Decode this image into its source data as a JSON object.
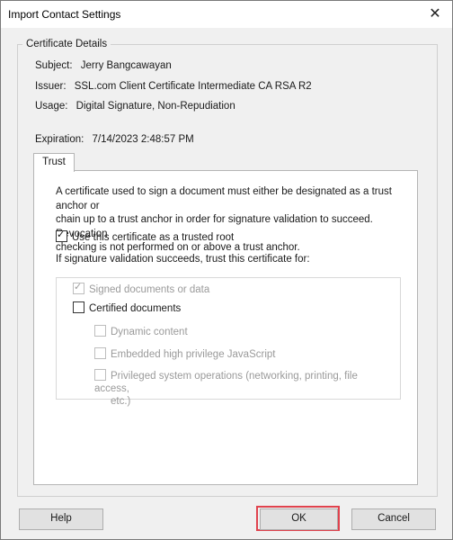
{
  "window": {
    "title": "Import Contact Settings",
    "close_glyph": "✕"
  },
  "details": {
    "legend": "Certificate Details",
    "subject_label": "Subject:",
    "subject_value": "Jerry Bangcawayan",
    "issuer_label": "Issuer:",
    "issuer_value": "SSL.com Client Certificate Intermediate CA RSA R2",
    "usage_label": "Usage:",
    "usage_value": "Digital Signature, Non-Repudiation",
    "expiration_label": "Expiration:",
    "expiration_value": "7/14/2023 2:48:57 PM"
  },
  "tabs": [
    {
      "label": "Trust",
      "active": true
    }
  ],
  "trust": {
    "description_line1": "A certificate used to sign a document must either be designated as a trust anchor or",
    "description_line2": "chain up to a trust anchor in order for signature validation to succeed.  Revocation",
    "description_line3": "checking is not performed on or above a trust anchor.",
    "use_trusted_root_label": "Use this certificate as a trusted root",
    "use_trusted_root_checked": true,
    "if_validation_label": "If signature validation succeeds, trust this certificate for:",
    "options": {
      "signed_documents": {
        "label": "Signed documents or data",
        "checked": true,
        "enabled": false
      },
      "certified_documents": {
        "label": "Certified documents",
        "checked": false,
        "enabled": true
      },
      "dynamic_content": {
        "label": "Dynamic content",
        "checked": false,
        "enabled": false
      },
      "embedded_js": {
        "label": "Embedded high privilege JavaScript",
        "checked": false,
        "enabled": false
      },
      "privileged_ops_line1": "Privileged system operations (networking, printing, file access,",
      "privileged_ops_line2": "etc.)",
      "privileged_ops_checked": false,
      "privileged_ops_enabled": false
    }
  },
  "buttons": {
    "help": "Help",
    "ok": "OK",
    "cancel": "Cancel"
  },
  "colors": {
    "highlight": "#e0434e",
    "disabled_text": "#9a9a9a",
    "window_bg": "#f0f0f0"
  }
}
